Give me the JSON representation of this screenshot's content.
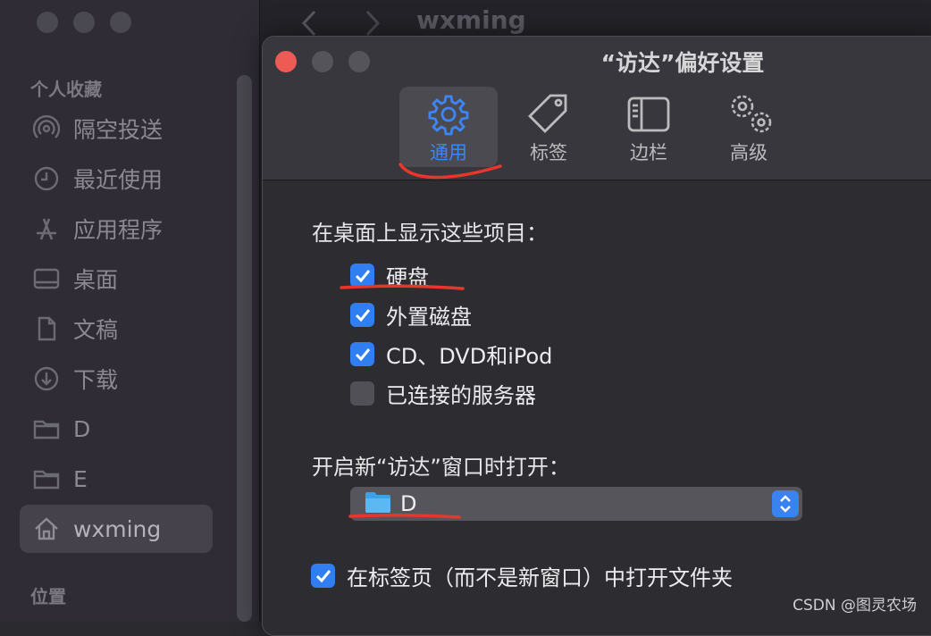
{
  "finder": {
    "title": "wxming",
    "favorites_label": "个人收藏",
    "locations_label": "位置",
    "sidebar": [
      {
        "label": "隔空投送",
        "icon": "airdrop-icon"
      },
      {
        "label": "最近使用",
        "icon": "clock-icon"
      },
      {
        "label": "应用程序",
        "icon": "applications-icon"
      },
      {
        "label": "桌面",
        "icon": "desktop-icon"
      },
      {
        "label": "文稿",
        "icon": "document-icon"
      },
      {
        "label": "下载",
        "icon": "download-icon"
      },
      {
        "label": "D",
        "icon": "folder-icon"
      },
      {
        "label": "E",
        "icon": "folder-icon"
      },
      {
        "label": "wxming",
        "icon": "home-icon",
        "selected": true
      }
    ]
  },
  "prefs": {
    "title": "“访达”偏好设置",
    "tabs": [
      {
        "label": "通用",
        "icon": "gear-icon",
        "active": true
      },
      {
        "label": "标签",
        "icon": "tag-icon"
      },
      {
        "label": "边栏",
        "icon": "sidebar-icon"
      },
      {
        "label": "高级",
        "icon": "gears-icon"
      }
    ],
    "desktop_heading": "在桌面上显示这些项目：",
    "desktop_items": [
      {
        "label": "硬盘",
        "checked": true
      },
      {
        "label": "外置磁盘",
        "checked": true
      },
      {
        "label": "CD、DVD和iPod",
        "checked": true
      },
      {
        "label": "已连接的服务器",
        "checked": false
      }
    ],
    "new_window_heading": "开启新“访达”窗口时打开：",
    "new_window_value": "D",
    "open_in_tabs": {
      "label": "在标签页（而不是新窗口）中打开文件夹",
      "checked": true
    }
  },
  "watermark": "CSDN @图灵农场",
  "colors": {
    "accent": "#2f7ef2",
    "annotation": "#e8362a",
    "close": "#ee5b55"
  }
}
